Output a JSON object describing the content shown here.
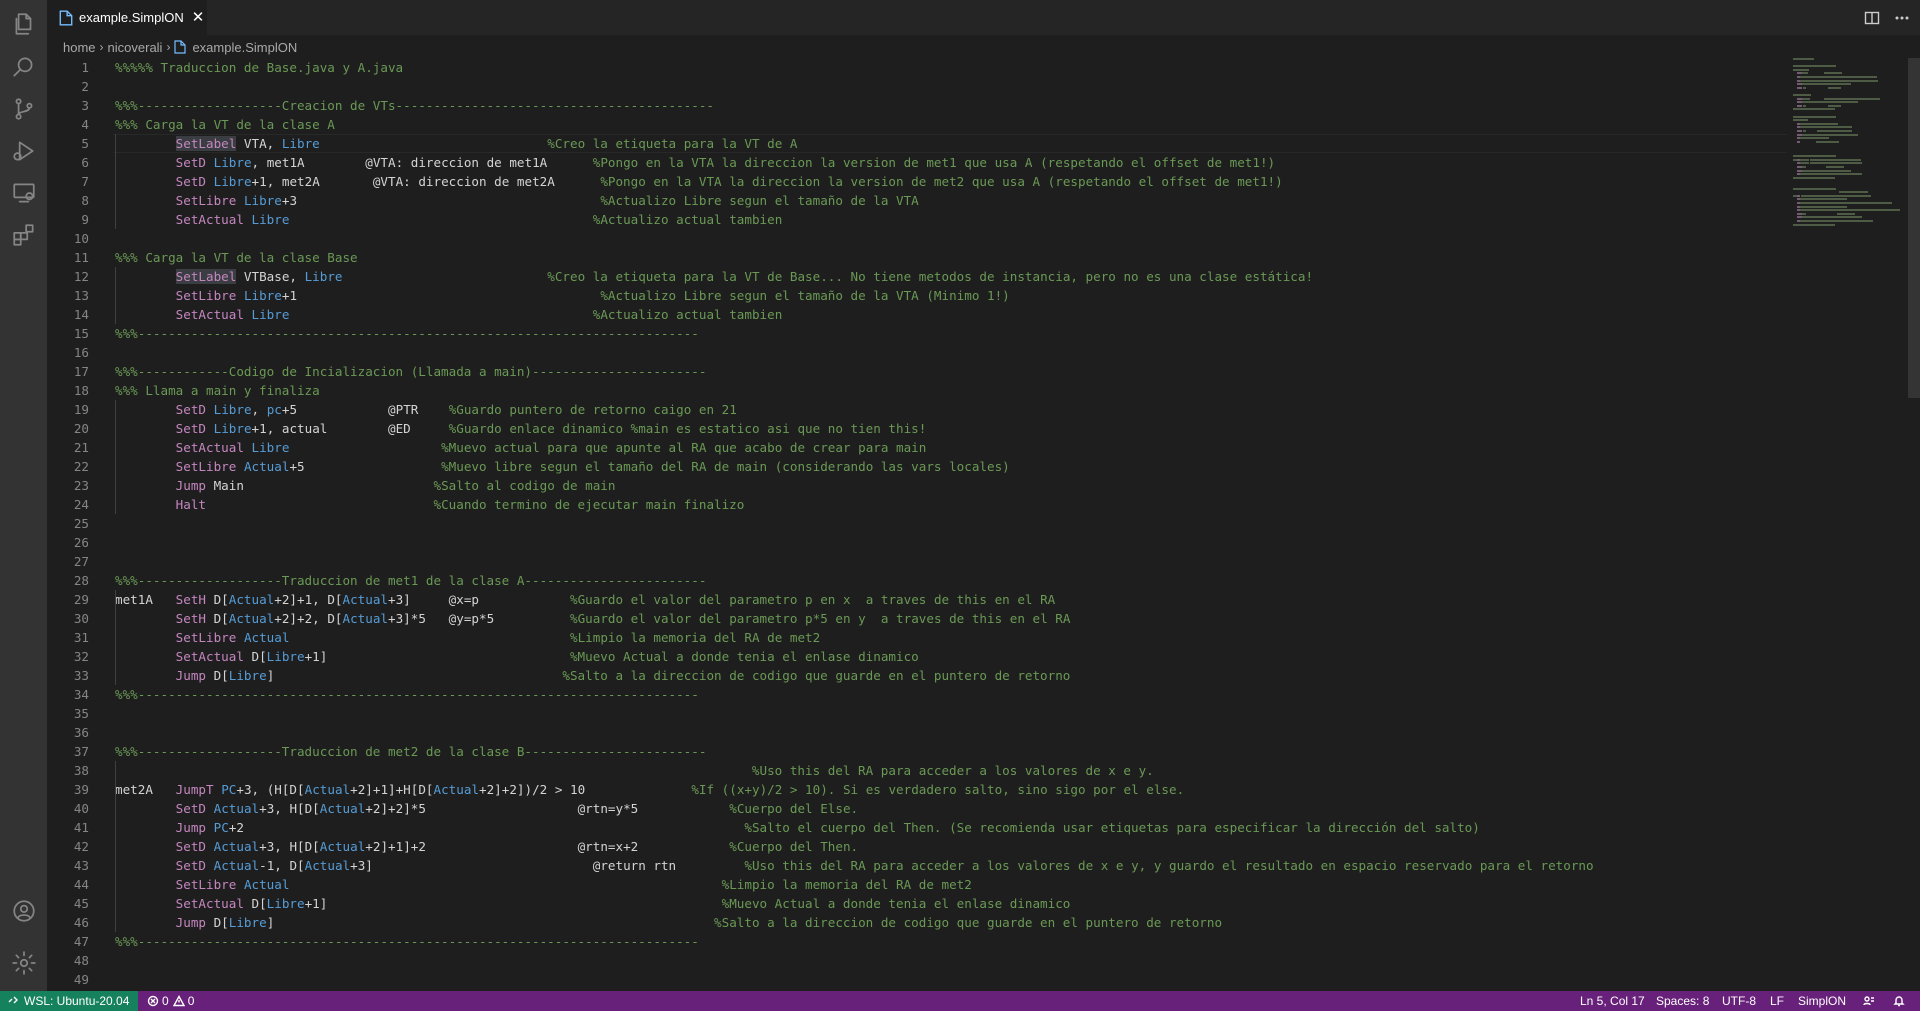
{
  "tab": {
    "title": "example.SimplON",
    "close": "✕"
  },
  "breadcrumb": [
    "home",
    "nicoverali",
    "example.SimplON"
  ],
  "activity_icons": [
    "files-icon",
    "search-icon",
    "source-control-icon",
    "run-debug-icon",
    "remote-explorer-icon",
    "extensions-icon",
    "account-icon",
    "settings-gear-icon"
  ],
  "colors": {
    "comment": "#6a9955",
    "keyword": "#c586c0",
    "variable": "#569cd6",
    "text": "#d4d4d4",
    "statusbar": "#68217a",
    "remote": "#16825d"
  },
  "editor": {
    "cursor_line": 5,
    "lines": [
      [
        [
          "c",
          "%%%%% Traduccion de Base.java y A.java"
        ]
      ],
      [],
      [
        [
          "c",
          "%%%-------------------Creacion de VTs------------------------------------------"
        ]
      ],
      [
        [
          "c",
          "%%% Carga la VT de la clase A"
        ]
      ],
      [
        [
          "t",
          "        "
        ],
        [
          "h",
          "SetLabel"
        ],
        [
          "t",
          " VTA, "
        ],
        [
          "v",
          "Libre"
        ],
        [
          "t",
          "                              "
        ],
        [
          "c",
          "%Creo la etiqueta para la VT de A"
        ]
      ],
      [
        [
          "t",
          "        "
        ],
        [
          "k",
          "SetD"
        ],
        [
          "t",
          " "
        ],
        [
          "v",
          "Libre"
        ],
        [
          "t",
          ", met1A        @VTA: direccion de met1A      "
        ],
        [
          "c",
          "%Pongo en la VTA la direccion la version de met1 que usa A (respetando el offset de met1!)"
        ]
      ],
      [
        [
          "t",
          "        "
        ],
        [
          "k",
          "SetD"
        ],
        [
          "t",
          " "
        ],
        [
          "v",
          "Libre"
        ],
        [
          "t",
          "+1, met2A       @VTA: direccion de met2A      "
        ],
        [
          "c",
          "%Pongo en la VTA la direccion la version de met2 que usa A (respetando el offset de met1!)"
        ]
      ],
      [
        [
          "t",
          "        "
        ],
        [
          "k",
          "SetLibre"
        ],
        [
          "t",
          " "
        ],
        [
          "v",
          "Libre"
        ],
        [
          "t",
          "+3                                        "
        ],
        [
          "c",
          "%Actualizo Libre segun el tamaño de la VTA"
        ]
      ],
      [
        [
          "t",
          "        "
        ],
        [
          "k",
          "SetActual"
        ],
        [
          "t",
          " "
        ],
        [
          "v",
          "Libre"
        ],
        [
          "t",
          "                                        "
        ],
        [
          "c",
          "%Actualizo actual tambien"
        ]
      ],
      [],
      [
        [
          "c",
          "%%% Carga la VT de la clase Base"
        ]
      ],
      [
        [
          "t",
          "        "
        ],
        [
          "h",
          "SetLabel"
        ],
        [
          "t",
          " VTBase, "
        ],
        [
          "v",
          "Libre"
        ],
        [
          "t",
          "                           "
        ],
        [
          "c",
          "%Creo la etiqueta para la VT de Base... No tiene metodos de instancia, pero no es una clase estática!"
        ]
      ],
      [
        [
          "t",
          "        "
        ],
        [
          "k",
          "SetLibre"
        ],
        [
          "t",
          " "
        ],
        [
          "v",
          "Libre"
        ],
        [
          "t",
          "+1                                        "
        ],
        [
          "c",
          "%Actualizo Libre segun el tamaño de la VTA (Minimo 1!)"
        ]
      ],
      [
        [
          "t",
          "        "
        ],
        [
          "k",
          "SetActual"
        ],
        [
          "t",
          " "
        ],
        [
          "v",
          "Libre"
        ],
        [
          "t",
          "                                        "
        ],
        [
          "c",
          "%Actualizo actual tambien"
        ]
      ],
      [
        [
          "c",
          "%%%--------------------------------------------------------------------------"
        ]
      ],
      [],
      [
        [
          "c",
          "%%%------------Codigo de Incializacion (Llamada a main)-----------------------"
        ]
      ],
      [
        [
          "c",
          "%%% Llama a main y finaliza"
        ]
      ],
      [
        [
          "t",
          "        "
        ],
        [
          "k",
          "SetD"
        ],
        [
          "t",
          " "
        ],
        [
          "v",
          "Libre"
        ],
        [
          "t",
          ", "
        ],
        [
          "v",
          "pc"
        ],
        [
          "t",
          "+5            @PTR    "
        ],
        [
          "c",
          "%Guardo puntero de retorno caigo en 21"
        ]
      ],
      [
        [
          "t",
          "        "
        ],
        [
          "k",
          "SetD"
        ],
        [
          "t",
          " "
        ],
        [
          "v",
          "Libre"
        ],
        [
          "t",
          "+1, actual        @ED     "
        ],
        [
          "c",
          "%Guardo enlace dinamico %main es estatico asi que no tien this!"
        ]
      ],
      [
        [
          "t",
          "        "
        ],
        [
          "k",
          "SetActual"
        ],
        [
          "t",
          " "
        ],
        [
          "v",
          "Libre"
        ],
        [
          "t",
          "                    "
        ],
        [
          "c",
          "%Muevo actual para que apunte al RA que acabo de crear para main"
        ]
      ],
      [
        [
          "t",
          "        "
        ],
        [
          "k",
          "SetLibre"
        ],
        [
          "t",
          " "
        ],
        [
          "v",
          "Actual"
        ],
        [
          "t",
          "+5                  "
        ],
        [
          "c",
          "%Muevo libre segun el tamaño del RA de main (considerando las vars locales)"
        ]
      ],
      [
        [
          "t",
          "        "
        ],
        [
          "k",
          "Jump"
        ],
        [
          "t",
          " Main                         "
        ],
        [
          "c",
          "%Salto al codigo de main"
        ]
      ],
      [
        [
          "t",
          "        "
        ],
        [
          "k",
          "Halt"
        ],
        [
          "t",
          "                              "
        ],
        [
          "c",
          "%Cuando termino de ejecutar main finalizo"
        ]
      ],
      [],
      [],
      [],
      [
        [
          "c",
          "%%%-------------------Traduccion de met1 de la clase A------------------------"
        ]
      ],
      [
        [
          "t",
          "met1A   "
        ],
        [
          "k",
          "SetH"
        ],
        [
          "t",
          " D["
        ],
        [
          "v",
          "Actual"
        ],
        [
          "t",
          "+2]+1, D["
        ],
        [
          "v",
          "Actual"
        ],
        [
          "t",
          "+3]     @x=p            "
        ],
        [
          "c",
          "%Guardo el valor del parametro p en x  a traves de this en el RA"
        ]
      ],
      [
        [
          "t",
          "        "
        ],
        [
          "k",
          "SetH"
        ],
        [
          "t",
          " D["
        ],
        [
          "v",
          "Actual"
        ],
        [
          "t",
          "+2]+2, D["
        ],
        [
          "v",
          "Actual"
        ],
        [
          "t",
          "+3]*5   @y=p*5          "
        ],
        [
          "c",
          "%Guardo el valor del parametro p*5 en y  a traves de this en el RA"
        ]
      ],
      [
        [
          "t",
          "        "
        ],
        [
          "k",
          "SetLibre"
        ],
        [
          "t",
          " "
        ],
        [
          "v",
          "Actual"
        ],
        [
          "t",
          "                                     "
        ],
        [
          "c",
          "%Limpio la memoria del RA de met2"
        ]
      ],
      [
        [
          "t",
          "        "
        ],
        [
          "k",
          "SetActual"
        ],
        [
          "t",
          " D["
        ],
        [
          "v",
          "Libre"
        ],
        [
          "t",
          "+1]                                "
        ],
        [
          "c",
          "%Muevo Actual a donde tenia el enlase dinamico"
        ]
      ],
      [
        [
          "t",
          "        "
        ],
        [
          "k",
          "Jump"
        ],
        [
          "t",
          " D["
        ],
        [
          "v",
          "Libre"
        ],
        [
          "t",
          "]                                      "
        ],
        [
          "c",
          "%Salto a la direccion de codigo que guarde en el puntero de retorno"
        ]
      ],
      [
        [
          "c",
          "%%%--------------------------------------------------------------------------"
        ]
      ],
      [],
      [],
      [
        [
          "c",
          "%%%-------------------Traduccion de met2 de la clase B------------------------"
        ]
      ],
      [
        [
          "t",
          "                                                                                    "
        ],
        [
          "c",
          "%Uso this del RA para acceder a los valores de x e y."
        ]
      ],
      [
        [
          "t",
          "met2A   "
        ],
        [
          "k",
          "JumpT"
        ],
        [
          "t",
          " "
        ],
        [
          "v",
          "PC"
        ],
        [
          "t",
          "+3, (H[D["
        ],
        [
          "v",
          "Actual"
        ],
        [
          "t",
          "+2]+1]+H[D["
        ],
        [
          "v",
          "Actual"
        ],
        [
          "t",
          "+2]+2])/2 > 10              "
        ],
        [
          "c",
          "%If ((x+y)/2 > 10). Si es verdadero salto, sino sigo por el else."
        ]
      ],
      [
        [
          "t",
          "        "
        ],
        [
          "k",
          "SetD"
        ],
        [
          "t",
          " "
        ],
        [
          "v",
          "Actual"
        ],
        [
          "t",
          "+3, H[D["
        ],
        [
          "v",
          "Actual"
        ],
        [
          "t",
          "+2]+2]*5                    @rtn=y*5            "
        ],
        [
          "c",
          "%Cuerpo del Else."
        ]
      ],
      [
        [
          "t",
          "        "
        ],
        [
          "k",
          "Jump"
        ],
        [
          "t",
          " "
        ],
        [
          "v",
          "PC"
        ],
        [
          "t",
          "+2                                                                  "
        ],
        [
          "c",
          "%Salto el cuerpo del Then. (Se recomienda usar etiquetas para especificar la dirección del salto)"
        ]
      ],
      [
        [
          "t",
          "        "
        ],
        [
          "k",
          "SetD"
        ],
        [
          "t",
          " "
        ],
        [
          "v",
          "Actual"
        ],
        [
          "t",
          "+3, H[D["
        ],
        [
          "v",
          "Actual"
        ],
        [
          "t",
          "+2]+1]+2                    @rtn=x+2            "
        ],
        [
          "c",
          "%Cuerpo del Then."
        ]
      ],
      [
        [
          "t",
          "        "
        ],
        [
          "k",
          "SetD"
        ],
        [
          "t",
          " "
        ],
        [
          "v",
          "Actual"
        ],
        [
          "t",
          "-1, D["
        ],
        [
          "v",
          "Actual"
        ],
        [
          "t",
          "+3]                             @return rtn         "
        ],
        [
          "c",
          "%Uso this del RA para acceder a los valores de x e y, y guardo el resultado en espacio reservado para el retorno"
        ]
      ],
      [
        [
          "t",
          "        "
        ],
        [
          "k",
          "SetLibre"
        ],
        [
          "t",
          " "
        ],
        [
          "v",
          "Actual"
        ],
        [
          "t",
          "                                                         "
        ],
        [
          "c",
          "%Limpio la memoria del RA de met2"
        ]
      ],
      [
        [
          "t",
          "        "
        ],
        [
          "k",
          "SetActual"
        ],
        [
          "t",
          " D["
        ],
        [
          "v",
          "Libre"
        ],
        [
          "t",
          "+1]                                                    "
        ],
        [
          "c",
          "%Muevo Actual a donde tenia el enlase dinamico"
        ]
      ],
      [
        [
          "t",
          "        "
        ],
        [
          "k",
          "Jump"
        ],
        [
          "t",
          " D["
        ],
        [
          "v",
          "Libre"
        ],
        [
          "t",
          "]                                                          "
        ],
        [
          "c",
          "%Salto a la direccion de codigo que guarde en el puntero de retorno"
        ]
      ],
      [
        [
          "c",
          "%%%--------------------------------------------------------------------------"
        ]
      ],
      [],
      []
    ]
  },
  "status": {
    "remote": "WSL: Ubuntu-20.04",
    "errors": "0",
    "warnings": "0",
    "position": "Ln 5, Col 17",
    "spaces": "Spaces: 8",
    "encoding": "UTF-8",
    "eol": "LF",
    "language": "SimplON"
  }
}
